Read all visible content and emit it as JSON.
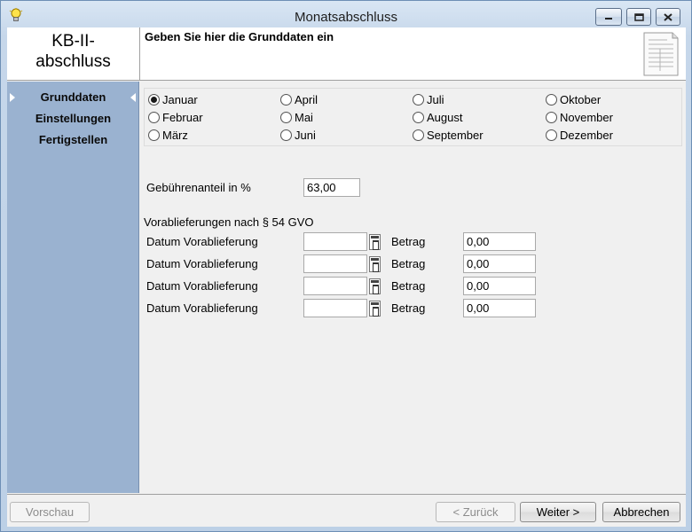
{
  "window": {
    "title": "Monatsabschluss"
  },
  "header": {
    "logo_line1": "KB-II-",
    "logo_line2": "abschluss",
    "instruction": "Geben Sie hier die Grunddaten ein"
  },
  "sidebar": {
    "items": [
      {
        "label": "Grunddaten",
        "active": true
      },
      {
        "label": "Einstellungen",
        "active": false
      },
      {
        "label": "Fertigstellen",
        "active": false
      }
    ]
  },
  "months": [
    {
      "label": "Januar",
      "checked": true
    },
    {
      "label": "Februar",
      "checked": false
    },
    {
      "label": "März",
      "checked": false
    },
    {
      "label": "April",
      "checked": false
    },
    {
      "label": "Mai",
      "checked": false
    },
    {
      "label": "Juni",
      "checked": false
    },
    {
      "label": "Juli",
      "checked": false
    },
    {
      "label": "August",
      "checked": false
    },
    {
      "label": "September",
      "checked": false
    },
    {
      "label": "Oktober",
      "checked": false
    },
    {
      "label": "November",
      "checked": false
    },
    {
      "label": "Dezember",
      "checked": false
    }
  ],
  "fee": {
    "label": "Gebührenanteil in %",
    "value": "63,00"
  },
  "advance": {
    "section_label": "Vorablieferungen nach § 54 GVO",
    "rows": [
      {
        "date_label": "Datum Vorablieferung",
        "date_value": "",
        "amount_label": "Betrag",
        "amount_value": "0,00"
      },
      {
        "date_label": "Datum Vorablieferung",
        "date_value": "",
        "amount_label": "Betrag",
        "amount_value": "0,00"
      },
      {
        "date_label": "Datum Vorablieferung",
        "date_value": "",
        "amount_label": "Betrag",
        "amount_value": "0,00"
      },
      {
        "date_label": "Datum Vorablieferung",
        "date_value": "",
        "amount_label": "Betrag",
        "amount_value": "0,00"
      }
    ]
  },
  "footer": {
    "preview": "Vorschau",
    "back": "< Zurück",
    "next": "Weiter >",
    "cancel": "Abbrechen"
  }
}
